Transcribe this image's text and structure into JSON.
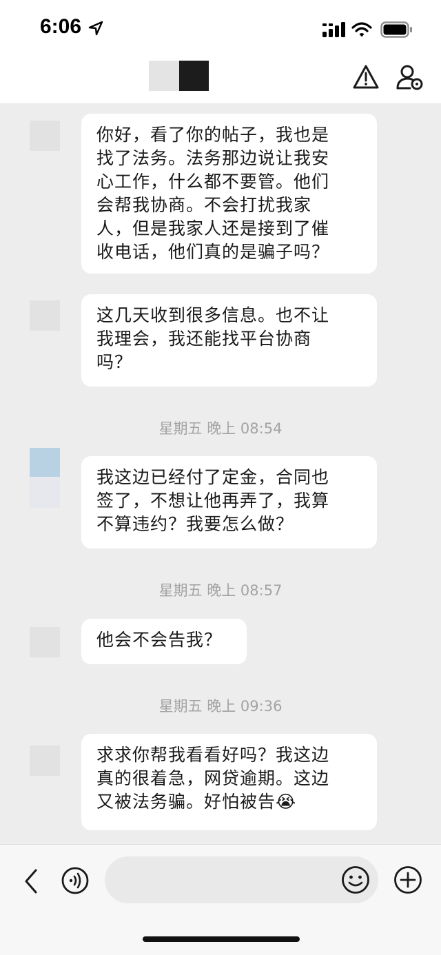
{
  "status_bar": {
    "time": "6:06",
    "icons": [
      "location-arrow-icon",
      "signal-icon",
      "wifi-icon",
      "battery-icon"
    ]
  },
  "header": {
    "icons": [
      "report-warning-icon",
      "user-settings-icon"
    ]
  },
  "messages": [
    {
      "type": "incoming",
      "lines": [
        "你好，看了你的帖子，我也是",
        "找了法务。法务那边说让我安",
        "心工作，什么都不要管。他们",
        "会帮我协商。不会打扰我家",
        "人，但是我家人还是接到了催",
        "收电话，他们真的是骗子吗？"
      ]
    },
    {
      "type": "incoming",
      "lines": [
        "这几天收到很多信息。也不让",
        "我理会，我还能找平台协商",
        "吗？"
      ]
    },
    {
      "type": "timestamp",
      "text": "星期五 晚上 08:54"
    },
    {
      "type": "incoming",
      "lines": [
        "我这边已经付了定金，合同也",
        "签了，不想让他再弄了，我算",
        "不算违约？我要怎么做？"
      ]
    },
    {
      "type": "timestamp",
      "text": "星期五 晚上 08:57"
    },
    {
      "type": "incoming",
      "lines": [
        "他会不会告我？"
      ]
    },
    {
      "type": "timestamp",
      "text": "星期五 晚上 09:36"
    },
    {
      "type": "incoming",
      "lines": [
        "求求你帮我看看好吗？我这边",
        "真的很着急，网贷逾期。这边",
        "又被法务骗。好怕被告"
      ],
      "emoji": "😭"
    }
  ],
  "bottom_bar": {
    "icons": [
      "back-chevron-icon",
      "voice-input-icon",
      "emoji-icon",
      "add-icon"
    ],
    "input_placeholder": ""
  }
}
